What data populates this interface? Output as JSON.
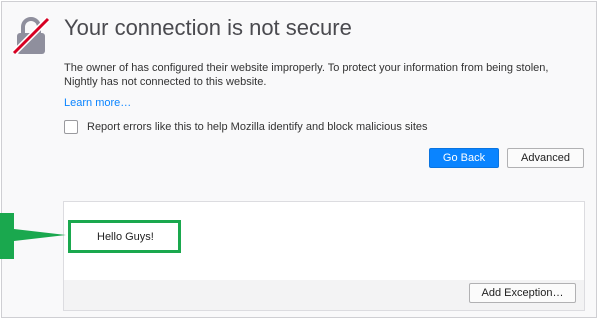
{
  "page": {
    "title": "Your connection is not secure",
    "message": "The owner of has configured their website improperly. To protect your information from being stolen, Nightly has not connected to this website.",
    "learn_more": "Learn more…",
    "report_checkbox_label": "Report errors like this to help Mozilla identify and block malicious sites",
    "report_checked": false
  },
  "buttons": {
    "go_back": "Go Back",
    "advanced": "Advanced",
    "add_exception": "Add Exception…"
  },
  "advanced_panel": {
    "highlighted_text": "Hello Guys!"
  },
  "icons": {
    "lock": "broken-lock-icon",
    "annotation_arrow": "green-arrow-icon"
  },
  "colors": {
    "accent_blue": "#0a84ff",
    "annotation_green": "#1aa84e",
    "lock_gray": "#8f8f9d",
    "slash_red": "#d70022"
  }
}
